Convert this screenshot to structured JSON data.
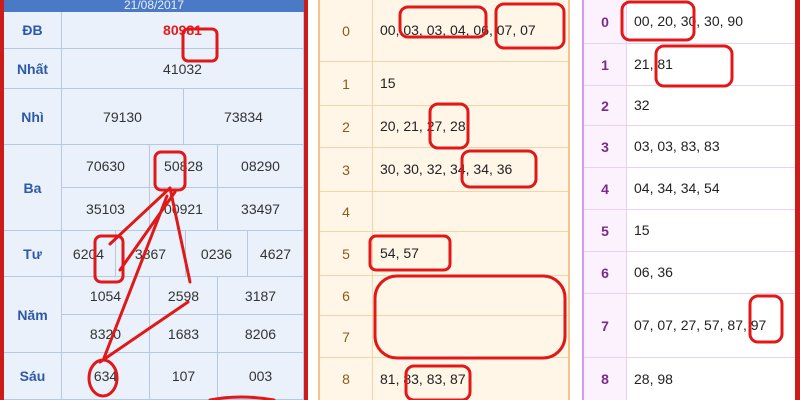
{
  "left": {
    "date": "21/08/2017",
    "labels": {
      "db": "ĐB",
      "nhat": "Nhất",
      "nhi": "Nhì",
      "ba": "Ba",
      "tu": "Tư",
      "nam": "Năm",
      "sau": "Sáu"
    },
    "db": "80981",
    "nhat": "41032",
    "nhi": [
      "79130",
      "73834"
    ],
    "ba": [
      "70630",
      "50828",
      "08290",
      "35103",
      "00921",
      "33497"
    ],
    "tu": [
      "6204",
      "3867",
      "0236",
      "4627"
    ],
    "nam": [
      "1054",
      "2598",
      "3187",
      "8320",
      "1683",
      "8206"
    ],
    "sau": [
      "634",
      "107",
      "003"
    ]
  },
  "middle": {
    "rows": [
      {
        "head": "0",
        "value": "00, 03, 03, 04, 06, 07, 07"
      },
      {
        "head": "1",
        "value": "15"
      },
      {
        "head": "2",
        "value": "20, 21, 27, 28"
      },
      {
        "head": "3",
        "value": "30, 30, 32, 34, 34, 36"
      },
      {
        "head": "4",
        "value": ""
      },
      {
        "head": "5",
        "value": "54, 57"
      },
      {
        "head": "6",
        "value": ""
      },
      {
        "head": "7",
        "value": ""
      },
      {
        "head": "8",
        "value": "81, 83, 83, 87"
      }
    ]
  },
  "right": {
    "rows": [
      {
        "head": "0",
        "value": "00, 20, 30, 30, 90"
      },
      {
        "head": "1",
        "value": "21, 81"
      },
      {
        "head": "2",
        "value": "32"
      },
      {
        "head": "3",
        "value": "03, 03, 83, 83"
      },
      {
        "head": "4",
        "value": "04, 34, 34, 54"
      },
      {
        "head": "5",
        "value": "15"
      },
      {
        "head": "6",
        "value": "06, 36"
      },
      {
        "head": "7",
        "value": "07, 07, 27, 57, 87, 97"
      },
      {
        "head": "8",
        "value": "28, 98"
      }
    ]
  },
  "colors": {
    "annotation": "#e01818",
    "frame": "#cc1b1b"
  }
}
